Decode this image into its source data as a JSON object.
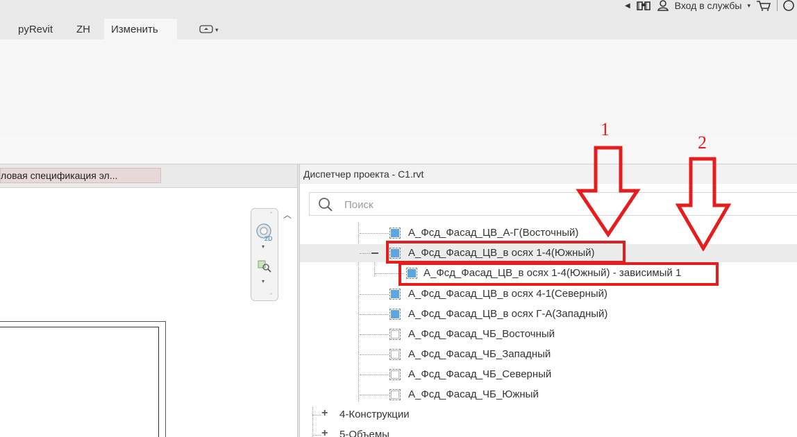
{
  "topbar": {
    "login_label": "Вход в службы",
    "login_arrow": "▾"
  },
  "ribbon_tabs": [
    {
      "label": "pyRevit"
    },
    {
      "label": "ZH"
    },
    {
      "label": "Изменить",
      "active": true
    }
  ],
  "view_tab": {
    "label": "ловая спецификация эл..."
  },
  "project_browser": {
    "title": "Диспетчер проекта - C1.rvt",
    "search_placeholder": "Поиск",
    "items": [
      {
        "label": "А_Фсд_Фасад_ЦВ_А-Г(Восточный)",
        "icon": "view-icon-blue"
      },
      {
        "label": "А_Фсд_Фасад_ЦВ_в осях 1-4(Южный)",
        "icon": "view-icon-blue",
        "state": "expanded",
        "selected": true
      },
      {
        "label": "А_Фсд_Фасад_ЦВ_в осях 1-4(Южный) - зависимый 1",
        "icon": "view-icon-blue",
        "dependent": true
      },
      {
        "label": "А_Фсд_Фасад_ЦВ_в осях 4-1(Северный)",
        "icon": "view-icon-blue"
      },
      {
        "label": "А_Фсд_Фасад_ЦВ_в осях Г-А(Западный)",
        "icon": "view-icon-blue"
      },
      {
        "label": "А_Фсд_Фасад_ЧБ_Восточный",
        "icon": "view-icon-white"
      },
      {
        "label": "А_Фсд_Фасад_ЧБ_Западный",
        "icon": "view-icon-white"
      },
      {
        "label": "А_Фсд_Фасад_ЧБ_Северный",
        "icon": "view-icon-white"
      },
      {
        "label": "А_Фсд_Фасад_ЧБ_Южный",
        "icon": "view-icon-white"
      }
    ],
    "groups": [
      {
        "label": "4-Конструкции"
      },
      {
        "label": "5-Объемы"
      }
    ]
  },
  "annotations": {
    "marker_1": "1",
    "marker_2": "2",
    "color": "#e51d1d"
  },
  "colors": {
    "view_icon_blue": "#5ba6e0",
    "selection_bg": "#ececec"
  }
}
